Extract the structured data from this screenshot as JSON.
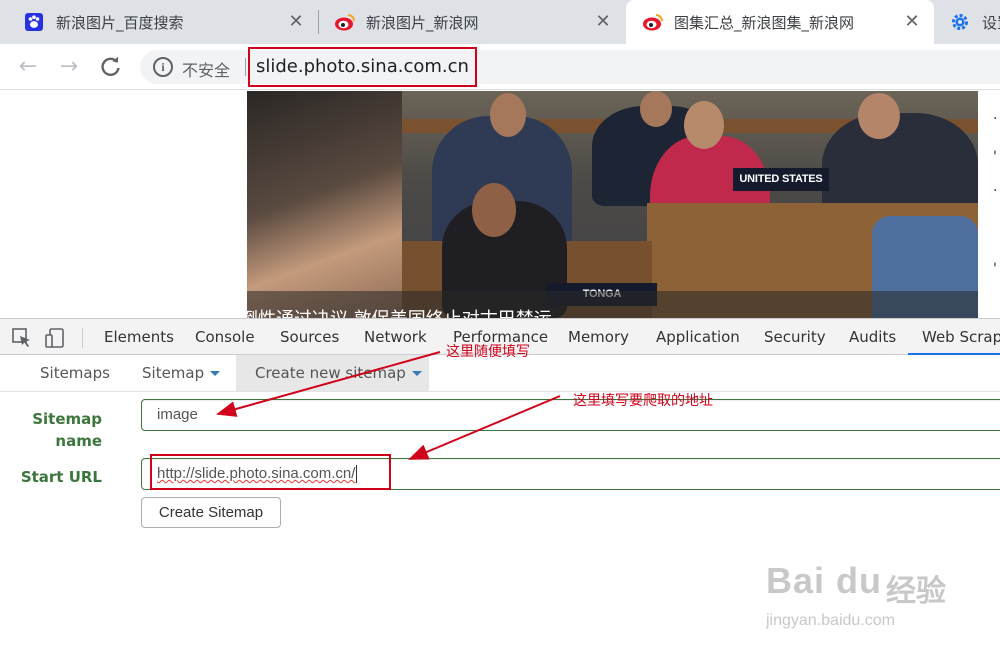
{
  "browser": {
    "tabs": [
      {
        "title": "新浪图片_百度搜索",
        "icon": "baidu-paw-icon"
      },
      {
        "title": "新浪图片_新浪网",
        "icon": "sina-weibo-icon"
      },
      {
        "title": "图集汇总_新浪图集_新浪网",
        "icon": "sina-weibo-icon",
        "active": true
      },
      {
        "title": "设置",
        "icon": "gear-icon"
      }
    ],
    "close_glyph": "✕",
    "security_label": "不安全",
    "url": "slide.photo.sina.com.cn"
  },
  "page": {
    "photo_caption": "联合国压倒性通过决议 敦促美国终止对古巴禁运",
    "placards": [
      "UNITED STATES",
      "TONGA"
    ],
    "right_edge_glyphs": [
      "·",
      "'",
      "·",
      "'"
    ]
  },
  "devtools": {
    "tabs": [
      "Elements",
      "Console",
      "Sources",
      "Network",
      "Performance",
      "Memory",
      "Application",
      "Security",
      "Audits",
      "Web Scraper"
    ],
    "active_tab": "Web Scraper"
  },
  "web_scraper": {
    "nav": {
      "sitemaps": "Sitemaps",
      "sitemap": "Sitemap",
      "create_new_sitemap": "Create new sitemap"
    },
    "form": {
      "sitemap_name_label": "Sitemap name",
      "sitemap_name_value": "image",
      "start_url_label": "Start URL",
      "start_url_value": "http://slide.photo.sina.com.cn/",
      "create_button": "Create Sitemap"
    }
  },
  "annotations": {
    "name_hint": "这里随便填写",
    "url_hint": "这里填写要爬取的地址",
    "color": "#d0021b"
  },
  "watermark": {
    "logo": "Bai du",
    "cn": "经验",
    "url": "jingyan.baidu.com"
  }
}
